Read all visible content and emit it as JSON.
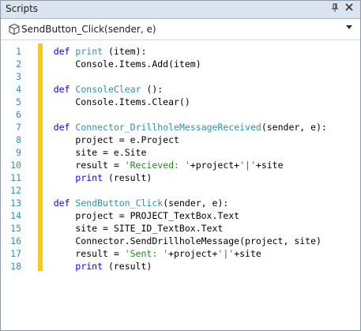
{
  "panel": {
    "title": "Scripts",
    "pin_glyph": "▾",
    "close_glyph": "✕"
  },
  "selector": {
    "value": "SendButton_Click(sender, e)",
    "icon": "cube-icon"
  },
  "colors": {
    "keyword": "#0000ff",
    "function_name": "#2b91af",
    "string": "#a31515",
    "line_number": "#2b91af",
    "change_bar": "#f2cb1d"
  },
  "lines": [
    {
      "n": "1",
      "tokens": [
        {
          "t": "    "
        },
        {
          "t": "def",
          "c": "kw"
        },
        {
          "t": " "
        },
        {
          "t": "print",
          "c": "fn"
        },
        {
          "t": " (item):"
        }
      ]
    },
    {
      "n": "2",
      "tokens": [
        {
          "t": "        Console.Items.Add(item)"
        }
      ]
    },
    {
      "n": "3",
      "tokens": []
    },
    {
      "n": "4",
      "tokens": [
        {
          "t": "    "
        },
        {
          "t": "def",
          "c": "kw"
        },
        {
          "t": " "
        },
        {
          "t": "ConsoleClear",
          "c": "fn"
        },
        {
          "t": " ():"
        }
      ]
    },
    {
      "n": "5",
      "tokens": [
        {
          "t": "        Console.Items.Clear()"
        }
      ]
    },
    {
      "n": "6",
      "tokens": []
    },
    {
      "n": "7",
      "tokens": [
        {
          "t": "    "
        },
        {
          "t": "def",
          "c": "kw"
        },
        {
          "t": " "
        },
        {
          "t": "Connector_DrillholeMessageReceived",
          "c": "fn"
        },
        {
          "t": "(sender, e):"
        }
      ]
    },
    {
      "n": "8",
      "tokens": [
        {
          "t": "        project = e.Project"
        }
      ]
    },
    {
      "n": "9",
      "tokens": [
        {
          "t": "        site = e.Site"
        }
      ]
    },
    {
      "n": "10",
      "tokens": [
        {
          "t": "        result = "
        },
        {
          "t": "'Recieved: '",
          "c": "str2"
        },
        {
          "t": "+project+"
        },
        {
          "t": "'|'",
          "c": "str2"
        },
        {
          "t": "+site"
        }
      ]
    },
    {
      "n": "11",
      "tokens": [
        {
          "t": "        "
        },
        {
          "t": "print",
          "c": "kw"
        },
        {
          "t": " (result)"
        }
      ]
    },
    {
      "n": "12",
      "tokens": []
    },
    {
      "n": "13",
      "tokens": [
        {
          "t": "    "
        },
        {
          "t": "def",
          "c": "kw"
        },
        {
          "t": " "
        },
        {
          "t": "SendButton_Click",
          "c": "fn"
        },
        {
          "t": "(sender, e):"
        }
      ]
    },
    {
      "n": "14",
      "tokens": [
        {
          "t": "        project = PROJECT_TextBox.Text"
        }
      ]
    },
    {
      "n": "15",
      "tokens": [
        {
          "t": "        site = SITE_ID_TextBox.Text"
        }
      ]
    },
    {
      "n": "16",
      "tokens": [
        {
          "t": "        Connector.SendDrillholeMessage(project, site)"
        }
      ]
    },
    {
      "n": "17",
      "tokens": [
        {
          "t": "        result = "
        },
        {
          "t": "'Sent: '",
          "c": "str2"
        },
        {
          "t": "+project+"
        },
        {
          "t": "'|'",
          "c": "str2"
        },
        {
          "t": "+site"
        }
      ]
    },
    {
      "n": "18",
      "tokens": [
        {
          "t": "        "
        },
        {
          "t": "print",
          "c": "kw"
        },
        {
          "t": " (result)"
        }
      ]
    }
  ]
}
